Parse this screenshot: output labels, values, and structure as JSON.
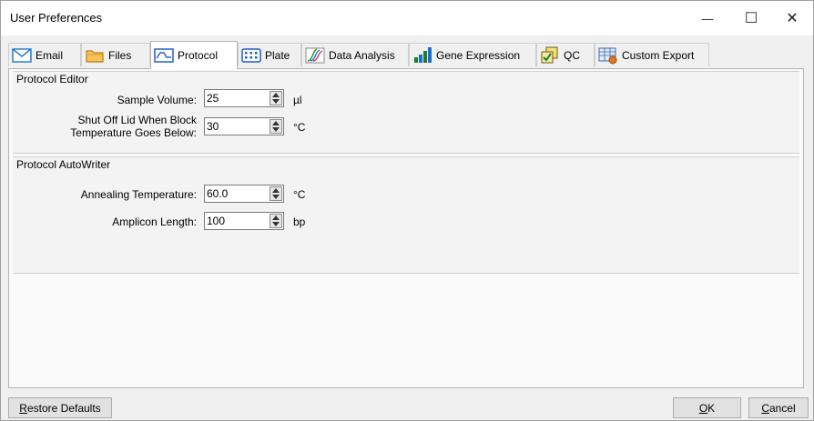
{
  "window": {
    "title": "User Preferences",
    "controls": {
      "minimize": "—",
      "maximize": "☐",
      "close": "✕"
    }
  },
  "tabs": [
    {
      "label": "Email",
      "icon": "envelope-icon",
      "active": false
    },
    {
      "label": "Files",
      "icon": "folder-icon",
      "active": false
    },
    {
      "label": "Protocol",
      "icon": "protocol-graph-icon",
      "active": true
    },
    {
      "label": "Plate",
      "icon": "plate-grid-icon",
      "active": false
    },
    {
      "label": "Data Analysis",
      "icon": "amplification-curves-icon",
      "active": false
    },
    {
      "label": "Gene Expression",
      "icon": "bar-graph-icon",
      "active": false
    },
    {
      "label": "QC",
      "icon": "checklist-icon",
      "active": false
    },
    {
      "label": "Custom Export",
      "icon": "export-spreadsheet-icon",
      "active": false
    }
  ],
  "protocol_editor": {
    "title": "Protocol Editor",
    "sample_volume": {
      "label": "Sample Volume:",
      "value": "25",
      "unit": "µl"
    },
    "shut_off_lid": {
      "label_line1": "Shut Off Lid When Block",
      "label_line2": "Temperature Goes Below:",
      "value": "30",
      "unit": "°C"
    }
  },
  "protocol_autowriter": {
    "title": "Protocol AutoWriter",
    "annealing_temperature": {
      "label": "Annealing Temperature:",
      "value": "60.0",
      "unit": "°C"
    },
    "amplicon_length": {
      "label": "Amplicon Length:",
      "value": "100",
      "unit": "bp"
    }
  },
  "buttons": {
    "restore_defaults": {
      "label": "Restore Defaults",
      "mnemonic": "R"
    },
    "ok": {
      "label": "OK",
      "mnemonic": "O"
    },
    "cancel": {
      "label": "Cancel",
      "mnemonic": "C"
    }
  },
  "colors": {
    "window_bg": "#f0f0f0",
    "active_tab_bg": "#ffffff",
    "button_bg": "#e1e1e1",
    "envelope_blue": "#2a7bd3",
    "folder_orange": "#e8a028",
    "plate_blue": "#1e5bd0",
    "bar_green": "#1a7f2e",
    "bar_blue": "#1e6bd8"
  }
}
